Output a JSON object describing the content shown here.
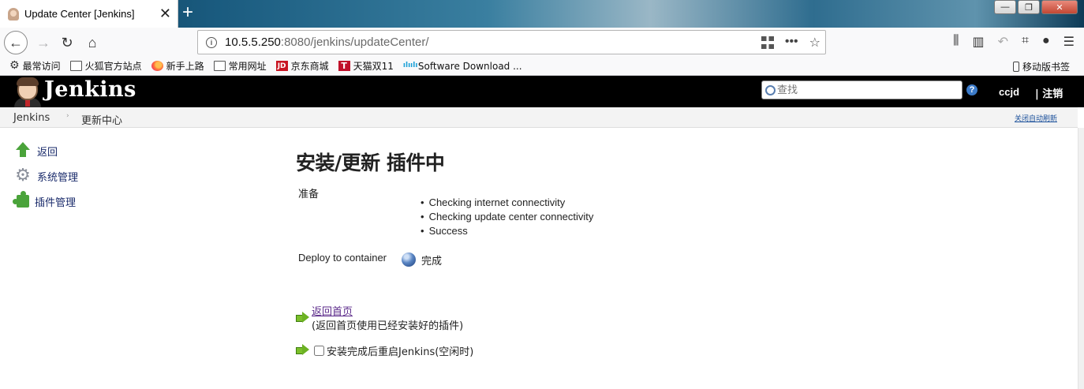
{
  "browser": {
    "tab_title": "Update Center [Jenkins]",
    "tab_close": "✕",
    "new_tab": "+",
    "url_host": "10.5.5.250",
    "url_path": ":8080/jenkins/updateCenter/",
    "bookmarks": [
      {
        "label": "最常访问",
        "icon": "gear-icon"
      },
      {
        "label": "火狐官方站点",
        "icon": "folder-icon"
      },
      {
        "label": "新手上路",
        "icon": "firefox-icon"
      },
      {
        "label": "常用网址",
        "icon": "folder-icon"
      },
      {
        "label": "京东商城",
        "icon": "jd-icon"
      },
      {
        "label": "天猫双11",
        "icon": "tmall-icon"
      },
      {
        "label": "Software Download ...",
        "icon": "cisco-icon"
      }
    ],
    "mobile_bookmarks": "移动版书签"
  },
  "jenkins": {
    "title": "Jenkins",
    "search_placeholder": "查找",
    "help": "?",
    "user": "ccjd",
    "logout": "| 注销"
  },
  "breadcrumb": {
    "items": [
      "Jenkins",
      "更新中心"
    ],
    "separator": "›",
    "auto_refresh": "关闭自动刷新"
  },
  "sidebar": {
    "items": [
      {
        "label": "返回",
        "icon": "up-arrow-icon"
      },
      {
        "label": "系统管理",
        "icon": "gear-icon"
      },
      {
        "label": "插件管理",
        "icon": "puzzle-icon"
      }
    ]
  },
  "main": {
    "title": "安装/更新 插件中",
    "prep_label": "准备",
    "checks": [
      "Checking internet connectivity",
      "Checking update center connectivity",
      "Success"
    ],
    "deploy_label": "Deploy to container",
    "deploy_status": "完成",
    "home_link": "返回首页",
    "home_desc": "(返回首页使用已经安装好的插件)",
    "restart_label": "安装完成后重启Jenkins(空闲时)"
  },
  "colors": {
    "jenkins_header": "#000000",
    "link": "#5b2a8a",
    "sidebar_link": "#1a2b6b"
  }
}
